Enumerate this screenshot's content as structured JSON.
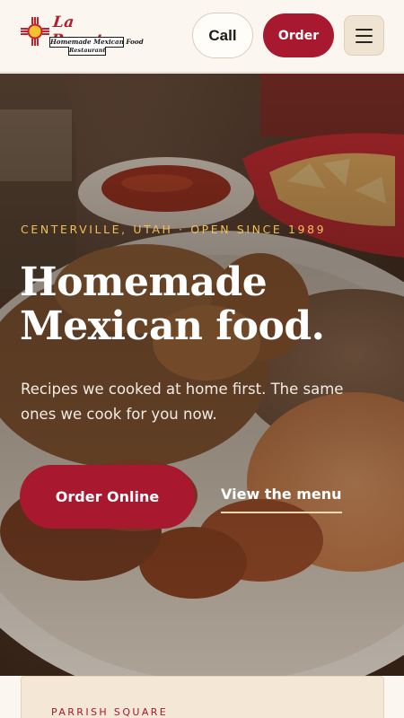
{
  "header": {
    "logo": {
      "name": "La Puente",
      "tagline": "Homemade Mexican Food",
      "sub": "Restaurant",
      "icon": "zia-sun-icon"
    },
    "call_label": "Call",
    "order_label": "Order",
    "menu_icon": "hamburger-menu-icon"
  },
  "hero": {
    "eyebrow": "CENTERVILLE, UTAH · OPEN SINCE 1989",
    "headline": "Homemade Mexican food.",
    "lede": "Recipes we cooked at home first. The same ones we cook for you now.",
    "primary_cta": "Order Online",
    "secondary_cta": "View the menu"
  },
  "card": {
    "kicker": "PARRISH SQUARE"
  },
  "colors": {
    "brand_red": "#a8182e",
    "accent_gold": "#efbf58",
    "cream": "#fbf7f0"
  }
}
